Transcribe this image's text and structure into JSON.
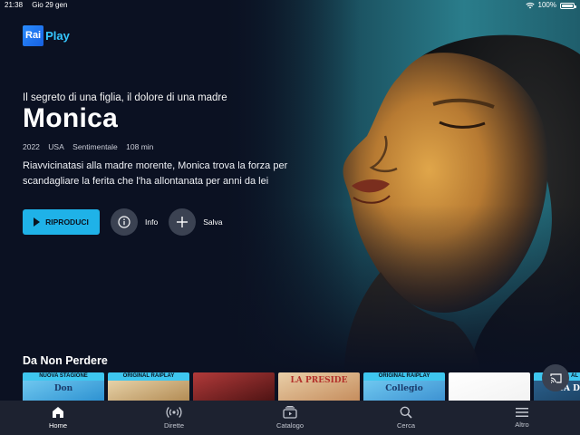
{
  "status_bar": {
    "time": "21:38",
    "date": "Gio 29 gen",
    "battery": "100%",
    "battery_level": 1.0
  },
  "logo": {
    "rai": "Rai",
    "play": "Play"
  },
  "hero": {
    "tagline": "Il segreto di una figlia, il dolore di una madre",
    "title": "Monica",
    "meta": [
      "2022",
      "USA",
      "Sentimentale",
      "108 min"
    ],
    "description": "Riavvicinatasi alla madre morente, Monica trova la forza per scandagliare la ferita che l'ha allontanata per anni da lei"
  },
  "actions": {
    "play_label": "RIPRODUCI",
    "info_label": "Info",
    "save_label": "Salva"
  },
  "section": {
    "title": "Da Non Perdere",
    "cards": [
      {
        "badge": "NUOVA STAGIONE",
        "art_text": "Don",
        "colors": [
          "#6fc7ef",
          "#2a8fd0"
        ]
      },
      {
        "badge": "ORIGINAL RAIPLAY",
        "art_text": "",
        "colors": [
          "#e7d2a8",
          "#b08850"
        ]
      },
      {
        "badge": "",
        "art_text": "",
        "colors": [
          "#b23a3a",
          "#4a1212"
        ]
      },
      {
        "badge": "",
        "art_text": "LA PRESIDE",
        "colors": [
          "#e9cfa8",
          "#c48a5a"
        ]
      },
      {
        "badge": "ORIGINAL RAIPLAY",
        "art_text": "Collegio",
        "colors": [
          "#6fc8f0",
          "#3b8fd0"
        ]
      },
      {
        "badge": "",
        "art_text": "",
        "colors": [
          "#ffffff",
          "#f2f2f2"
        ]
      },
      {
        "badge": "AL",
        "art_text": "VITA DI UN",
        "colors": [
          "#2a5f8a",
          "#183a5a"
        ]
      }
    ]
  },
  "tabbar": {
    "items": [
      {
        "label": "Home",
        "icon": "home-icon",
        "active": true
      },
      {
        "label": "Dirette",
        "icon": "broadcast-icon",
        "active": false
      },
      {
        "label": "Catalogo",
        "icon": "catalog-icon",
        "active": false
      },
      {
        "label": "Cerca",
        "icon": "search-icon",
        "active": false
      },
      {
        "label": "Altro",
        "icon": "menu-icon",
        "active": false
      }
    ]
  },
  "colors": {
    "accent": "#1fb2e8",
    "badge": "#3ec6ef",
    "background": "#0b1122",
    "tabbar": "#1d2230"
  }
}
